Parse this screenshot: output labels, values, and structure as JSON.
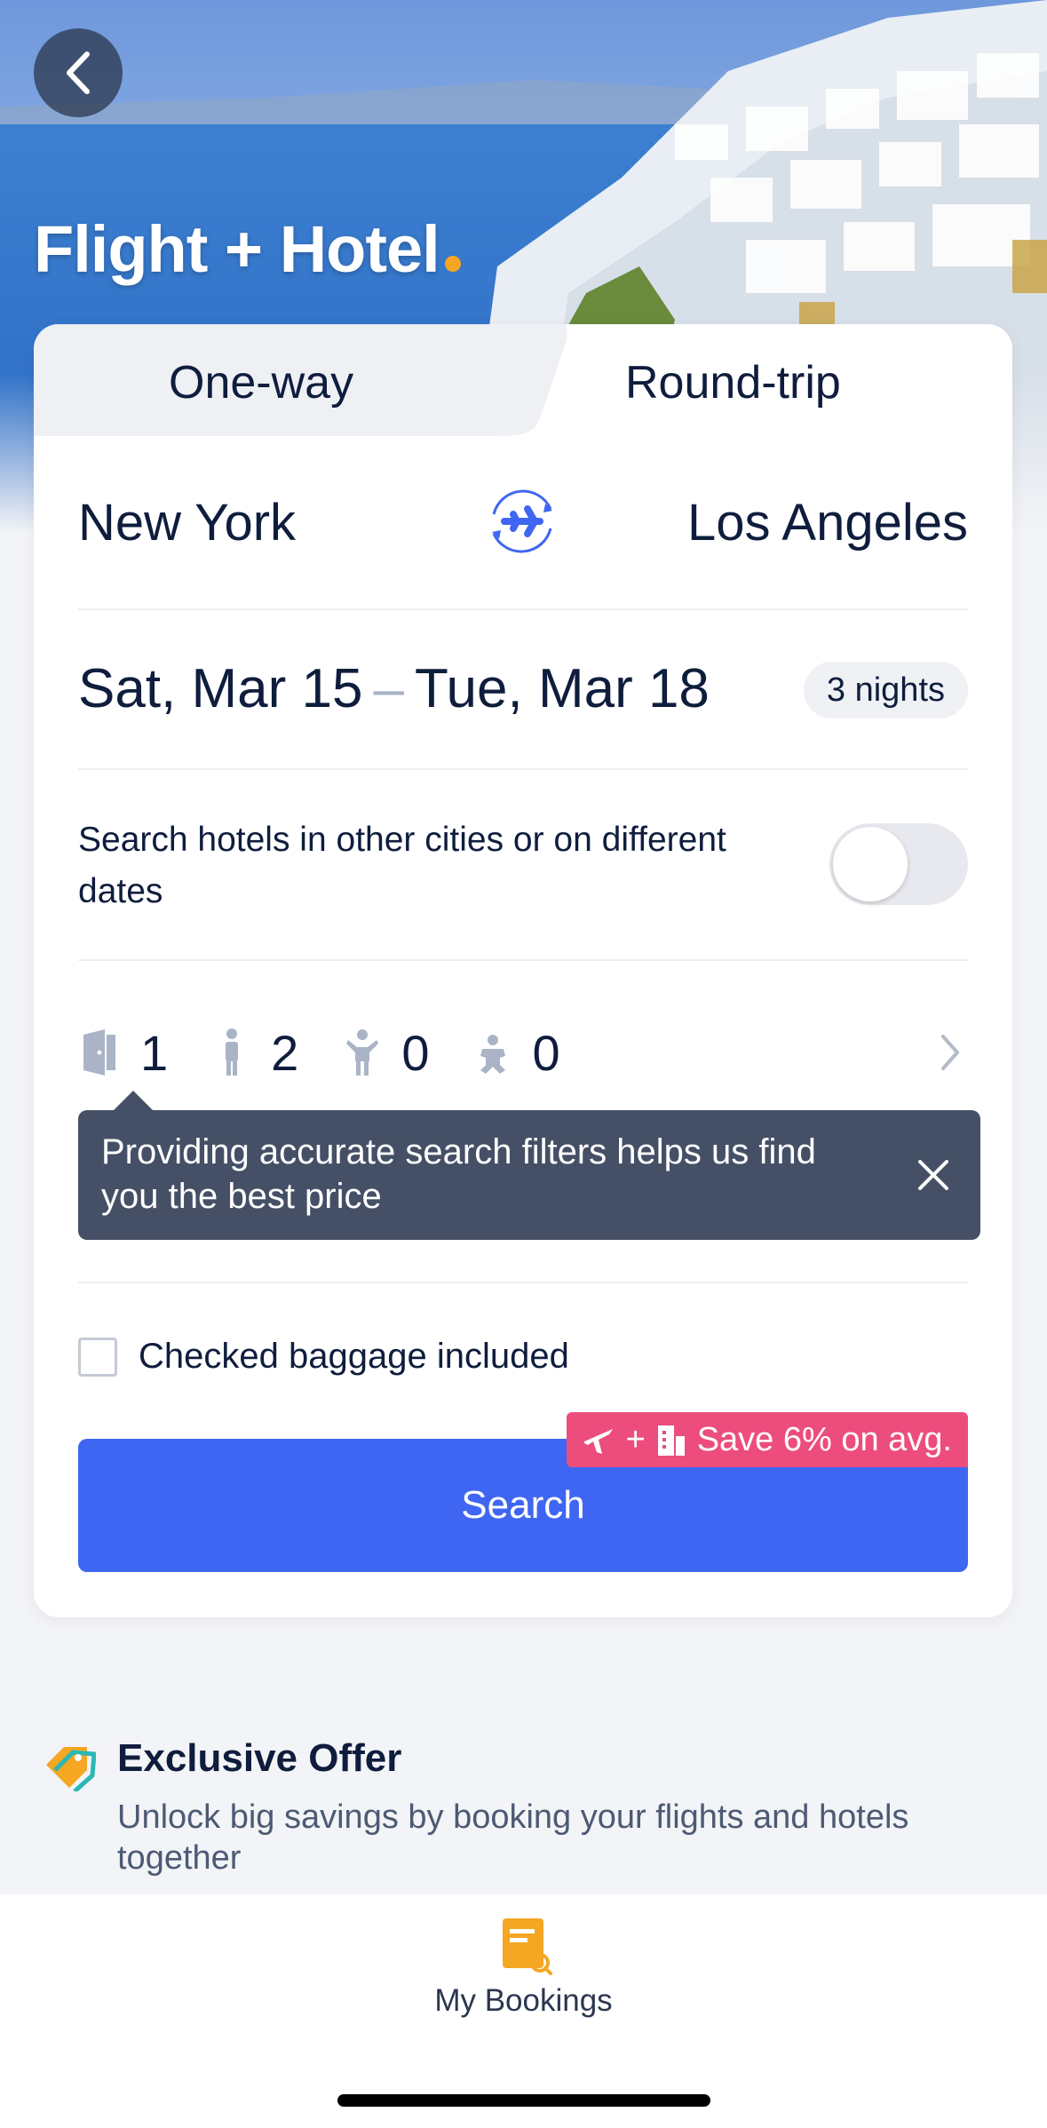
{
  "header": {
    "title": "Flight + Hotel"
  },
  "tabs": [
    {
      "label": "One-way",
      "selected": false
    },
    {
      "label": "Round-trip",
      "selected": true
    }
  ],
  "route": {
    "origin": "New York",
    "destination": "Los Angeles"
  },
  "dates": {
    "depart": "Sat, Mar 15",
    "separator": "–",
    "return": "Tue, Mar 18",
    "nights": "3 nights"
  },
  "hotel_options": {
    "other_cities_label": "Search hotels in other cities or on different dates",
    "toggle_on": false
  },
  "guests": {
    "rooms": "1",
    "adults": "2",
    "children": "0",
    "infants": "0"
  },
  "tooltip": {
    "text": "Providing accurate search filters helps us find you the best price"
  },
  "baggage": {
    "label": "Checked baggage included",
    "checked": false
  },
  "search": {
    "button_label": "Search",
    "promo_plus": "+",
    "promo_text": "Save 6% on avg."
  },
  "offer": {
    "title": "Exclusive Offer",
    "description": "Unlock big savings by booking your flights and hotels together"
  },
  "bottom_nav": {
    "bookings_label": "My Bookings"
  },
  "colors": {
    "primary": "#3f66f2",
    "promo": "#ec4d7d",
    "accent": "#f5a623",
    "text": "#0f1d3d",
    "tooltip_bg": "#455066"
  }
}
